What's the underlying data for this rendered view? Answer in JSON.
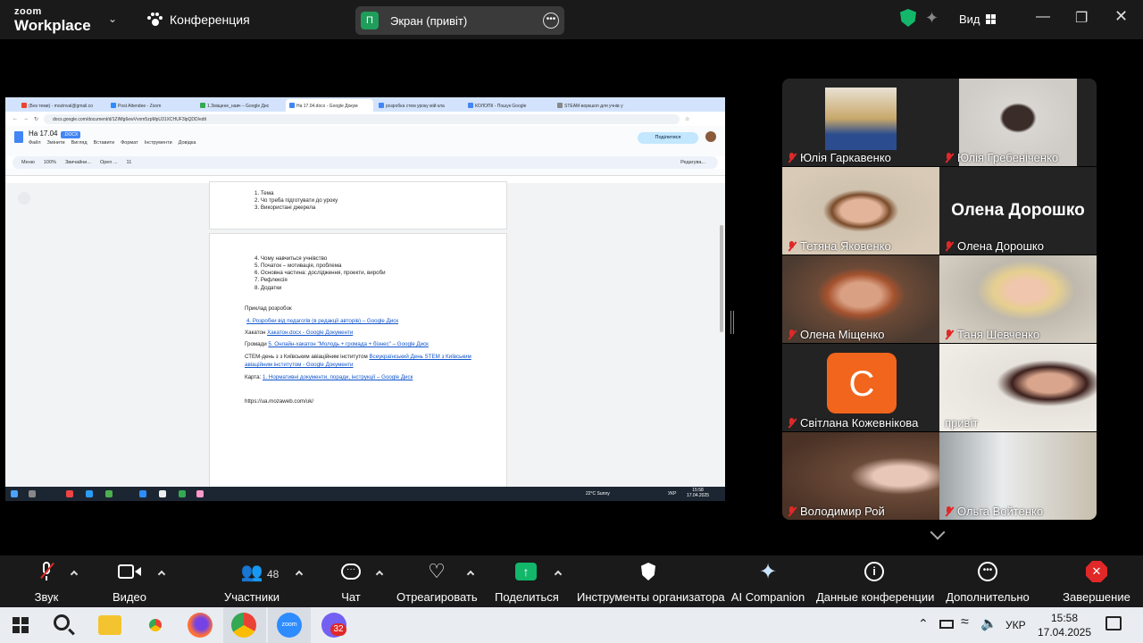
{
  "zoom": {
    "brand_line1": "zoom",
    "brand_line2": "Workplace",
    "meeting_menu": "Конференция",
    "screen_share_avatar": "П",
    "screen_share_label": "Экран (привіт)",
    "view_label": "Вид"
  },
  "browser": {
    "tabs": [
      "(Без теми) - mozinval@gmail.co",
      "Post Attendee - Zoom",
      "1.Зміщене_навч – Google Дис",
      "На 17.04.docx - Google Докум",
      "розробка стем уроку мій кла",
      "КОЛОПК - Пошук Google",
      "STEAM-воркшоп для учнів у"
    ],
    "url": "docs.google.com/document/d/1ZiNfg6ewVvnm5zpMpU31XCHUF3lpQDD/edit"
  },
  "doc": {
    "title": "На 17.04",
    "badge": ".DOCX",
    "menu": [
      "Файл",
      "Змінити",
      "Вигляд",
      "Вставити",
      "Формат",
      "Інструменти",
      "Довідка"
    ],
    "share_label": "Поділитися",
    "toolbar": [
      "Меню",
      "100%",
      "Звичайни...",
      "Open ...",
      "11",
      "Редагува..."
    ],
    "page1_lines": [
      "1.   Тема",
      "2.   Чо треба підготувати до уроку",
      "3.   Використані джерела"
    ],
    "page2_list": [
      "4.   Чому навчиться учнівство",
      "5.   Початок – мотивація, проблема",
      "6.   Основна частина: дослідження, проекти, вироби",
      "7.   Рефлексія",
      "8.   Додатки"
    ],
    "example_heading": "Приклад розробок",
    "link1": "4. Розробки від педагогів (в редакції авторів) – Google Диск",
    "hack_prefix": "Хакатон",
    "hack_link": "Хакатон.docx - Google Документи",
    "comm_prefix": "Громади",
    "comm_link": "5. Онлайн-хакатон \"Молодь + громада + бізнес\" – Google Диск",
    "stem_prefix": "СТЕМ-день з  з Київським авіаційним інститутом",
    "stem_link_a": "Всеукраїнський День STEM з Київським",
    "stem_link_b": "авіаційним інститутом - Google Документи",
    "map_prefix": "Карта:",
    "map_link": "1. Нормативні документи, поради, інструкції – Google Диск",
    "plain_url": "https://ua.mozaweb.com/uk/",
    "taskbar_weather": "22°C  Sunny",
    "taskbar_lang": "УКР",
    "taskbar_time": "15:58",
    "taskbar_date": "17.04.2025"
  },
  "participants": [
    {
      "name": "Юлія Гаркавенко"
    },
    {
      "name": "Юлія Гребеніченко"
    },
    {
      "name": "Тетяна Яковенко"
    },
    {
      "name": "Олена Дорошко"
    },
    {
      "name": "Олена Міщенко"
    },
    {
      "name": "Таня Шевченко"
    },
    {
      "name": "Світлана Кожевнікова",
      "initial": "С"
    },
    {
      "name": "привіт"
    },
    {
      "name": "Володимир Рой"
    },
    {
      "name": "Ольга Войтенко"
    }
  ],
  "controls": {
    "audio": "Звук",
    "video": "Видео",
    "participants": "Участники",
    "participants_count": "48",
    "chat": "Чат",
    "react": "Отреагировать",
    "share": "Поделиться",
    "host_tools": "Инструменты организатора",
    "ai": "AI Companion",
    "info": "Данные конференции",
    "more": "Дополнительно",
    "end": "Завершение"
  },
  "windows": {
    "lang": "УКР",
    "time": "15:58",
    "date": "17.04.2025",
    "badge": "32"
  },
  "colors": {
    "zoom_bg": "#1a1a1a",
    "share_green": "#12b76a",
    "mute_red": "#e02828",
    "active_speaker": "#23d18b",
    "avatar_orange": "#f2651c"
  }
}
